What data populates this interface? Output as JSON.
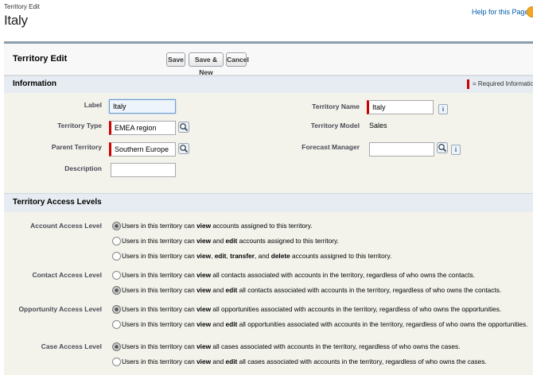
{
  "header": {
    "breadcrumb": "Territory Edit",
    "title": "Italy",
    "help_link": "Help for this Page"
  },
  "panel": {
    "title": "Territory Edit",
    "buttons": {
      "save": "Save",
      "save_new": "Save & New",
      "cancel": "Cancel"
    }
  },
  "information": {
    "title": "Information",
    "required_note": "= Required Information",
    "fields": {
      "label": {
        "label": "Label",
        "value": "Italy"
      },
      "territory_type": {
        "label": "Territory Type",
        "value": "EMEA region"
      },
      "parent_territory": {
        "label": "Parent Territory",
        "value": "Southern Europe"
      },
      "description": {
        "label": "Description",
        "value": ""
      },
      "territory_name": {
        "label": "Territory Name",
        "value": "Italy"
      },
      "territory_model": {
        "label": "Territory Model",
        "value": "Sales"
      },
      "forecast_manager": {
        "label": "Forecast Manager",
        "value": ""
      }
    },
    "info_glyph": "i"
  },
  "access": {
    "title": "Territory Access Levels",
    "groups": [
      {
        "label": "Account Access Level",
        "selected": 0,
        "options": [
          [
            "Users in this territory can ",
            "view",
            " accounts assigned to this territory."
          ],
          [
            "Users in this territory can ",
            "view",
            " and ",
            "edit",
            " accounts assigned to this territory."
          ],
          [
            "Users in this territory can ",
            "view",
            ", ",
            "edit",
            ", ",
            "transfer",
            ", and ",
            "delete",
            " accounts assigned to this territory."
          ]
        ]
      },
      {
        "label": "Contact Access Level",
        "selected": 1,
        "options": [
          [
            "Users in this territory can ",
            "view",
            " all contacts associated with accounts in the territory, regardless of who owns the contacts."
          ],
          [
            "Users in this territory can ",
            "view",
            " and ",
            "edit",
            " all contacts associated with accounts in the territory, regardless of who owns the contacts."
          ]
        ]
      },
      {
        "label": "Opportunity Access Level",
        "selected": 0,
        "options": [
          [
            "Users in this territory can ",
            "view",
            " all opportunities associated with accounts in the territory, regardless of who owns the opportunities."
          ],
          [
            "Users in this territory can ",
            "view",
            " and ",
            "edit",
            " all opportunities associated with accounts in the territory, regardless of who owns the opportunities."
          ]
        ]
      },
      {
        "label": "Case Access Level",
        "selected": 0,
        "options": [
          [
            "Users in this territory can ",
            "view",
            " all cases associated with accounts in the territory, regardless of who owns the cases."
          ],
          [
            "Users in this territory can ",
            "view",
            " and ",
            "edit",
            " all cases associated with accounts in the territory, regardless of who owns the cases."
          ]
        ]
      }
    ]
  },
  "icons": {
    "lookup": "magnifier-lookup-icon",
    "help": "help-icon",
    "info": "info-icon"
  }
}
